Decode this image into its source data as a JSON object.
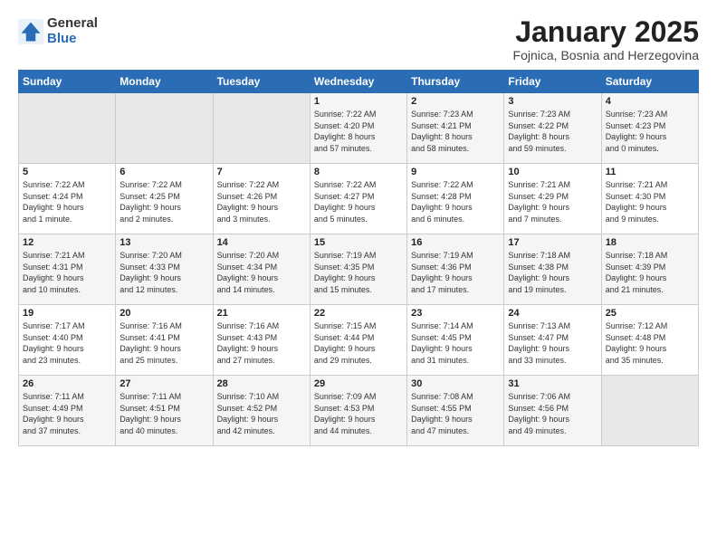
{
  "header": {
    "logo_general": "General",
    "logo_blue": "Blue",
    "month_year": "January 2025",
    "location": "Fojnica, Bosnia and Herzegovina"
  },
  "days_of_week": [
    "Sunday",
    "Monday",
    "Tuesday",
    "Wednesday",
    "Thursday",
    "Friday",
    "Saturday"
  ],
  "weeks": [
    [
      {
        "day": "",
        "empty": true
      },
      {
        "day": "",
        "empty": true
      },
      {
        "day": "",
        "empty": true
      },
      {
        "day": "1",
        "lines": [
          "Sunrise: 7:22 AM",
          "Sunset: 4:20 PM",
          "Daylight: 8 hours",
          "and 57 minutes."
        ]
      },
      {
        "day": "2",
        "lines": [
          "Sunrise: 7:23 AM",
          "Sunset: 4:21 PM",
          "Daylight: 8 hours",
          "and 58 minutes."
        ]
      },
      {
        "day": "3",
        "lines": [
          "Sunrise: 7:23 AM",
          "Sunset: 4:22 PM",
          "Daylight: 8 hours",
          "and 59 minutes."
        ]
      },
      {
        "day": "4",
        "lines": [
          "Sunrise: 7:23 AM",
          "Sunset: 4:23 PM",
          "Daylight: 9 hours",
          "and 0 minutes."
        ]
      }
    ],
    [
      {
        "day": "5",
        "lines": [
          "Sunrise: 7:22 AM",
          "Sunset: 4:24 PM",
          "Daylight: 9 hours",
          "and 1 minute."
        ]
      },
      {
        "day": "6",
        "lines": [
          "Sunrise: 7:22 AM",
          "Sunset: 4:25 PM",
          "Daylight: 9 hours",
          "and 2 minutes."
        ]
      },
      {
        "day": "7",
        "lines": [
          "Sunrise: 7:22 AM",
          "Sunset: 4:26 PM",
          "Daylight: 9 hours",
          "and 3 minutes."
        ]
      },
      {
        "day": "8",
        "lines": [
          "Sunrise: 7:22 AM",
          "Sunset: 4:27 PM",
          "Daylight: 9 hours",
          "and 5 minutes."
        ]
      },
      {
        "day": "9",
        "lines": [
          "Sunrise: 7:22 AM",
          "Sunset: 4:28 PM",
          "Daylight: 9 hours",
          "and 6 minutes."
        ]
      },
      {
        "day": "10",
        "lines": [
          "Sunrise: 7:21 AM",
          "Sunset: 4:29 PM",
          "Daylight: 9 hours",
          "and 7 minutes."
        ]
      },
      {
        "day": "11",
        "lines": [
          "Sunrise: 7:21 AM",
          "Sunset: 4:30 PM",
          "Daylight: 9 hours",
          "and 9 minutes."
        ]
      }
    ],
    [
      {
        "day": "12",
        "lines": [
          "Sunrise: 7:21 AM",
          "Sunset: 4:31 PM",
          "Daylight: 9 hours",
          "and 10 minutes."
        ]
      },
      {
        "day": "13",
        "lines": [
          "Sunrise: 7:20 AM",
          "Sunset: 4:33 PM",
          "Daylight: 9 hours",
          "and 12 minutes."
        ]
      },
      {
        "day": "14",
        "lines": [
          "Sunrise: 7:20 AM",
          "Sunset: 4:34 PM",
          "Daylight: 9 hours",
          "and 14 minutes."
        ]
      },
      {
        "day": "15",
        "lines": [
          "Sunrise: 7:19 AM",
          "Sunset: 4:35 PM",
          "Daylight: 9 hours",
          "and 15 minutes."
        ]
      },
      {
        "day": "16",
        "lines": [
          "Sunrise: 7:19 AM",
          "Sunset: 4:36 PM",
          "Daylight: 9 hours",
          "and 17 minutes."
        ]
      },
      {
        "day": "17",
        "lines": [
          "Sunrise: 7:18 AM",
          "Sunset: 4:38 PM",
          "Daylight: 9 hours",
          "and 19 minutes."
        ]
      },
      {
        "day": "18",
        "lines": [
          "Sunrise: 7:18 AM",
          "Sunset: 4:39 PM",
          "Daylight: 9 hours",
          "and 21 minutes."
        ]
      }
    ],
    [
      {
        "day": "19",
        "lines": [
          "Sunrise: 7:17 AM",
          "Sunset: 4:40 PM",
          "Daylight: 9 hours",
          "and 23 minutes."
        ]
      },
      {
        "day": "20",
        "lines": [
          "Sunrise: 7:16 AM",
          "Sunset: 4:41 PM",
          "Daylight: 9 hours",
          "and 25 minutes."
        ]
      },
      {
        "day": "21",
        "lines": [
          "Sunrise: 7:16 AM",
          "Sunset: 4:43 PM",
          "Daylight: 9 hours",
          "and 27 minutes."
        ]
      },
      {
        "day": "22",
        "lines": [
          "Sunrise: 7:15 AM",
          "Sunset: 4:44 PM",
          "Daylight: 9 hours",
          "and 29 minutes."
        ]
      },
      {
        "day": "23",
        "lines": [
          "Sunrise: 7:14 AM",
          "Sunset: 4:45 PM",
          "Daylight: 9 hours",
          "and 31 minutes."
        ]
      },
      {
        "day": "24",
        "lines": [
          "Sunrise: 7:13 AM",
          "Sunset: 4:47 PM",
          "Daylight: 9 hours",
          "and 33 minutes."
        ]
      },
      {
        "day": "25",
        "lines": [
          "Sunrise: 7:12 AM",
          "Sunset: 4:48 PM",
          "Daylight: 9 hours",
          "and 35 minutes."
        ]
      }
    ],
    [
      {
        "day": "26",
        "lines": [
          "Sunrise: 7:11 AM",
          "Sunset: 4:49 PM",
          "Daylight: 9 hours",
          "and 37 minutes."
        ]
      },
      {
        "day": "27",
        "lines": [
          "Sunrise: 7:11 AM",
          "Sunset: 4:51 PM",
          "Daylight: 9 hours",
          "and 40 minutes."
        ]
      },
      {
        "day": "28",
        "lines": [
          "Sunrise: 7:10 AM",
          "Sunset: 4:52 PM",
          "Daylight: 9 hours",
          "and 42 minutes."
        ]
      },
      {
        "day": "29",
        "lines": [
          "Sunrise: 7:09 AM",
          "Sunset: 4:53 PM",
          "Daylight: 9 hours",
          "and 44 minutes."
        ]
      },
      {
        "day": "30",
        "lines": [
          "Sunrise: 7:08 AM",
          "Sunset: 4:55 PM",
          "Daylight: 9 hours",
          "and 47 minutes."
        ]
      },
      {
        "day": "31",
        "lines": [
          "Sunrise: 7:06 AM",
          "Sunset: 4:56 PM",
          "Daylight: 9 hours",
          "and 49 minutes."
        ]
      },
      {
        "day": "",
        "empty": true
      }
    ]
  ]
}
